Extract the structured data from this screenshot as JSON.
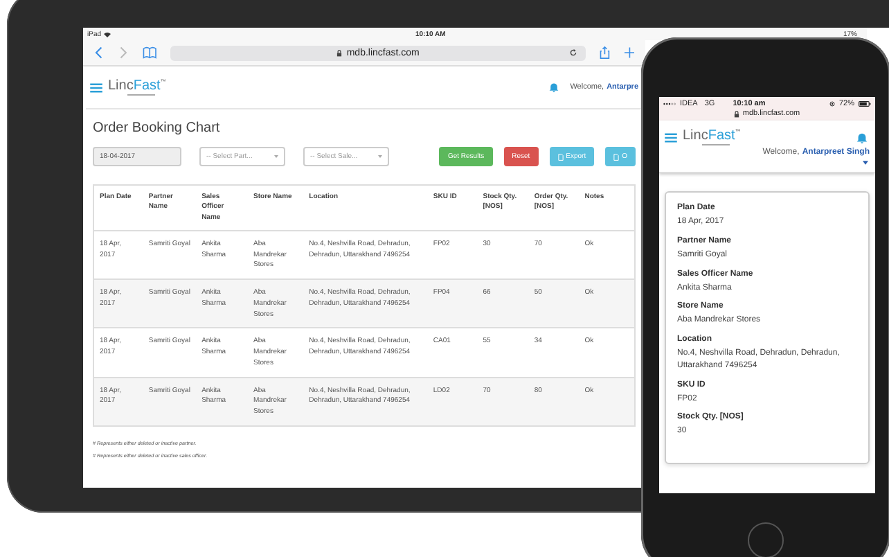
{
  "tablet": {
    "status_bar": {
      "device": "iPad",
      "time": "10:10 AM",
      "battery": "17%"
    },
    "browser": {
      "url": "mdb.lincfast.com"
    },
    "header": {
      "logo": {
        "main": "Linc",
        "accent": "Fast",
        "mark": "™"
      },
      "welcome": "Welcome,",
      "user": "Antarpre"
    },
    "page_title": "Order Booking Chart",
    "filters": [
      {
        "kind": "date",
        "value": "18-04-2017"
      },
      {
        "kind": "select",
        "placeholder": "-- Select Part..."
      },
      {
        "kind": "select",
        "placeholder": "-- Select Sale..."
      }
    ],
    "buttons": [
      {
        "kind": "text",
        "label": "Get Results",
        "color": "#5cb85c"
      },
      {
        "kind": "text",
        "label": "Reset",
        "color": "#d9534f"
      },
      {
        "kind": "icon",
        "label": "Export",
        "color": "#5bc0de"
      },
      {
        "kind": "icon",
        "label": "O",
        "color": "#5bc0de"
      }
    ],
    "table": {
      "columns": [
        "Plan Date",
        "Partner Name",
        "Sales Officer Name",
        "Store Name",
        "Location",
        "SKU ID",
        "Stock Qty. [NOS]",
        "Order Qty. [NOS]",
        "Notes"
      ],
      "rows": [
        [
          "18 Apr, 2017",
          "Samriti Goyal",
          "Ankita Sharma",
          "Aba Mandrekar Stores",
          "No.4, Neshvilla Road, Dehradun, Dehradun, Uttarakhand 7496254",
          "FP02",
          "30",
          "70",
          "Ok"
        ],
        [
          "18 Apr, 2017",
          "Samriti Goyal",
          "Ankita Sharma",
          "Aba Mandrekar Stores",
          "No.4, Neshvilla Road, Dehradun, Dehradun, Uttarakhand 7496254",
          "FP04",
          "66",
          "50",
          "Ok"
        ],
        [
          "18 Apr, 2017",
          "Samriti Goyal",
          "Ankita Sharma",
          "Aba Mandrekar Stores",
          "No.4, Neshvilla Road, Dehradun, Dehradun, Uttarakhand 7496254",
          "CA01",
          "55",
          "34",
          "Ok"
        ],
        [
          "18 Apr, 2017",
          "Samriti Goyal",
          "Ankita Sharma",
          "Aba Mandrekar Stores",
          "No.4, Neshvilla Road, Dehradun, Dehradun, Uttarakhand 7496254",
          "LD02",
          "70",
          "80",
          "Ok"
        ]
      ]
    },
    "footnotes": [
      "# Represents either deleted or inactive partner.",
      "# Represents either deleted or inactive sales officer."
    ]
  },
  "phone": {
    "status_bar": {
      "carrier": "IDEA",
      "network": "3G",
      "time": "10:10 am",
      "battery": "72%"
    },
    "url": "mdb.lincfast.com",
    "header": {
      "logo": {
        "main": "Linc",
        "accent": "Fast",
        "mark": "™"
      },
      "welcome": "Welcome,",
      "user": "Antarpreet Singh"
    },
    "card": [
      {
        "label": "Plan Date",
        "value": "18 Apr, 2017"
      },
      {
        "label": "Partner Name",
        "value": "Samriti Goyal"
      },
      {
        "label": "Sales Officer Name",
        "value": "Ankita Sharma"
      },
      {
        "label": "Store Name",
        "value": "Aba Mandrekar Stores"
      },
      {
        "label": "Location",
        "value": "No.4, Neshvilla Road, Dehradun, Dehradun, Uttarakhand 7496254"
      },
      {
        "label": "SKU ID",
        "value": "FP02"
      },
      {
        "label": "Stock Qty. [NOS]",
        "value": "30"
      }
    ]
  }
}
